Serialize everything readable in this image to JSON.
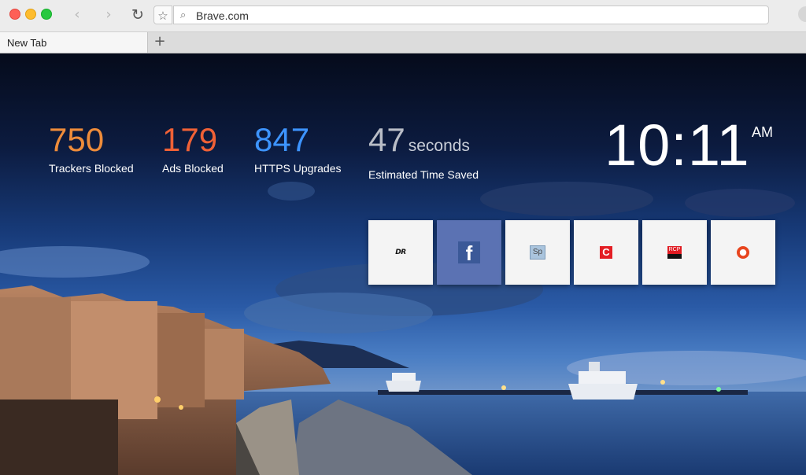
{
  "browser": {
    "address": "Brave.com",
    "tab_title": "New Tab",
    "new_tab_symbol": "+",
    "back_symbol": "‹",
    "forward_symbol": "›",
    "reload_symbol": "↻",
    "bookmark_symbol": "☆",
    "search_symbol": "⌕"
  },
  "stats": [
    {
      "value": "750",
      "label": "Trackers Blocked",
      "color": "#ee8c3a"
    },
    {
      "value": "179",
      "label": "Ads Blocked",
      "color": "#f06136"
    },
    {
      "value": "847",
      "label": "HTTPS Upgrades",
      "color": "#3d94ff"
    },
    {
      "value": "47",
      "unit": "seconds",
      "label": "Estimated Time Saved",
      "color": "#b9bdc6"
    }
  ],
  "clock": {
    "time": "10:11",
    "ampm": "AM"
  },
  "top_sites": [
    {
      "name": "dr-logo",
      "text": "DR"
    },
    {
      "name": "facebook-logo",
      "text": "f"
    },
    {
      "name": "sp-logo",
      "text": "Sp"
    },
    {
      "name": "c-logo",
      "text": "C"
    },
    {
      "name": "rcp-logo",
      "text": "RCP"
    },
    {
      "name": "ring-logo",
      "text": "●"
    }
  ]
}
